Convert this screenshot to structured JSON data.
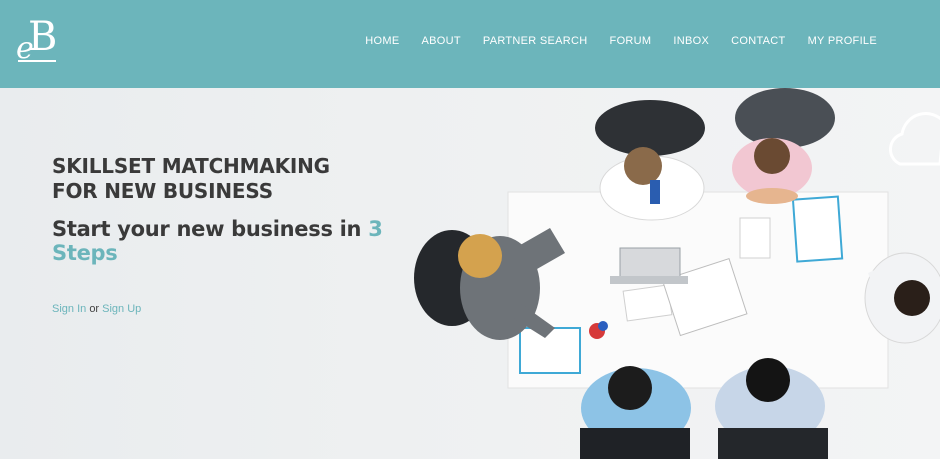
{
  "header": {
    "logo_text": "eB",
    "nav": [
      {
        "label": "HOME"
      },
      {
        "label": "ABOUT"
      },
      {
        "label": "PARTNER SEARCH"
      },
      {
        "label": "FORUM"
      },
      {
        "label": "INBOX"
      },
      {
        "label": "CONTACT"
      },
      {
        "label": "MY PROFILE"
      }
    ]
  },
  "hero": {
    "headline_line1": "SKILLSET MATCHMAKING",
    "headline_line2": "FOR NEW BUSINESS",
    "subhead_prefix": "Start your new business in",
    "subhead_accent_line1": "3",
    "subhead_accent_line2": "Steps",
    "sign_in": "Sign In",
    "or": "or",
    "sign_up": "Sign Up"
  },
  "colors": {
    "header_bg": "#6cb5bb",
    "accent": "#6cb5bb",
    "heading": "#3a3a3a",
    "hero_bg": "#eceeef"
  },
  "icons": [
    "cloud-icon"
  ]
}
